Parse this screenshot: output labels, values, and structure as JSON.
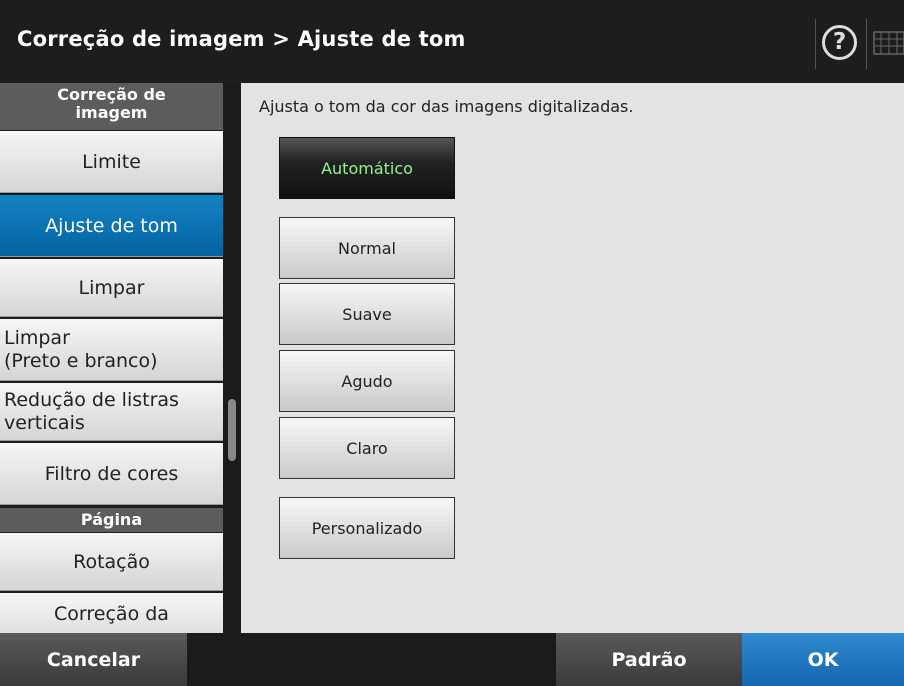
{
  "header": {
    "title": "Correção de imagem > Ajuste de tom",
    "help_glyph": "?",
    "help_icon": "help-circle-icon",
    "keyboard_icon": "keyboard-icon"
  },
  "sidebar": {
    "section_image": "Correção de\nimagem",
    "items": [
      {
        "label": "Limite"
      },
      {
        "label": "Ajuste de tom",
        "active": true
      },
      {
        "label": "Limpar"
      },
      {
        "label": "Limpar\n(Preto e branco)"
      },
      {
        "label": "Redução de listras\nverticais"
      },
      {
        "label": "Filtro de cores"
      }
    ],
    "section_page": "Página",
    "page_items": [
      {
        "label": "Rotação"
      },
      {
        "label": "Correção da"
      }
    ]
  },
  "content": {
    "description": "Ajusta o tom da cor das imagens digitalizadas.",
    "options": [
      {
        "label": "Automático",
        "selected": true
      },
      {
        "label": "Normal"
      },
      {
        "label": "Suave"
      },
      {
        "label": "Agudo"
      },
      {
        "label": "Claro"
      },
      {
        "label": "Personalizado"
      }
    ]
  },
  "footer": {
    "cancel": "Cancelar",
    "default": "Padrão",
    "ok": "OK"
  },
  "colors": {
    "active_blue": "#0a74b6",
    "ok_blue": "#1f74c0",
    "selected_text_green": "#8ff58f"
  }
}
